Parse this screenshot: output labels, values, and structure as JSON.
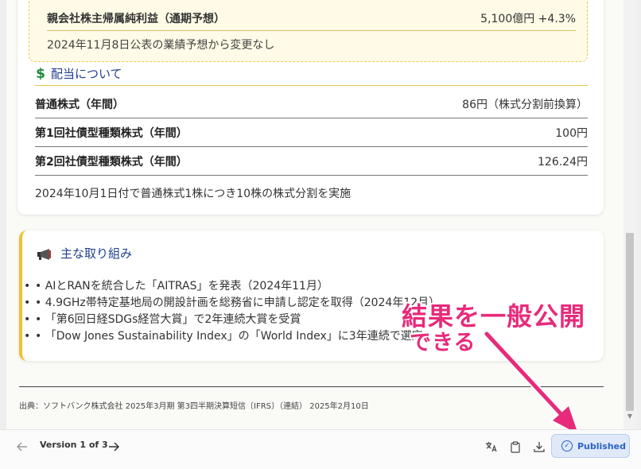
{
  "forecast": {
    "label": "親会社株主帰属純利益（通期予想）",
    "value": "5,100億円 +4.3%",
    "note": "2024年11月8日公表の業績予想から変更なし"
  },
  "dividend": {
    "icon": "dollar-icon",
    "title": "配当について",
    "rows": [
      {
        "label": "普通株式（年間）",
        "value": "86円（株式分割前換算）"
      },
      {
        "label": "第1回社債型種類株式（年間）",
        "value": "100円"
      },
      {
        "label": "第2回社債型種類株式（年間）",
        "value": "126.24円"
      }
    ],
    "note": "2024年10月1日付で普通株式1株につき10株の株式分割を実施"
  },
  "initiatives": {
    "icon": "megaphone-icon",
    "title": "主な取り組み",
    "items": [
      "AIとRANを統合した「AITRAS」を発表（2024年11月）",
      "4.9GHz帯特定基地局の開設計画を総務省に申請し認定を取得（2024年12月）",
      "「第6回日経SDGs経営大賞」で2年連続大賞を受賞",
      "「Dow Jones Sustainability Index」の「World Index」に3年連続で選定"
    ]
  },
  "source": "出典：ソフトバンク株式会社 2025年3月期 第3四半期決算短信〔IFRS〕（連結） 2025年2月10日",
  "annotation": {
    "line1": "結果を一般公開",
    "line2": "できる",
    "color": "#e82a7a"
  },
  "toolbar": {
    "prev_icon": "arrow-left-icon",
    "version": "Version 1 of 3",
    "next_icon": "arrow-right-icon",
    "translate_icon": "translate-icon",
    "copy_icon": "clipboard-icon",
    "download_icon": "download-icon",
    "published_label": "Published",
    "published_color": "#2b62c9"
  }
}
